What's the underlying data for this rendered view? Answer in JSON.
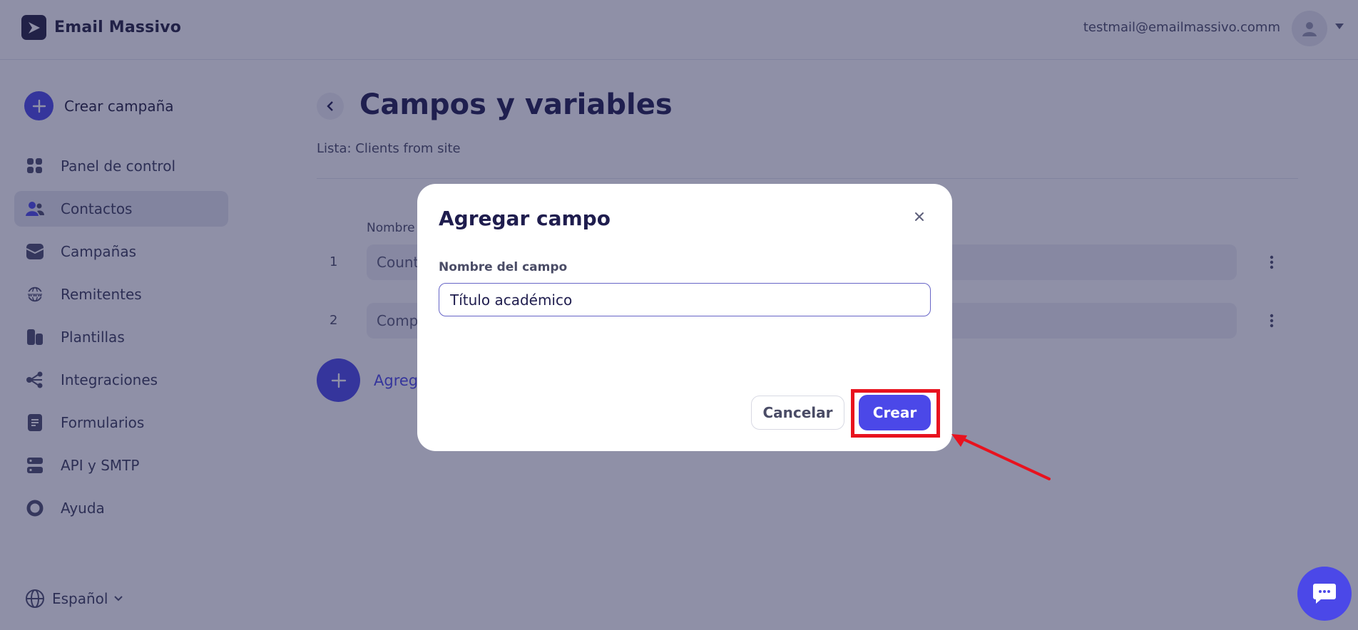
{
  "app": {
    "name": "Email Massivo",
    "user_email": "testmail@emailmassivo.comm"
  },
  "sidebar": {
    "create_label": "Crear campaña",
    "items": [
      {
        "label": "Panel de control",
        "icon": "dashboard-icon"
      },
      {
        "label": "Contactos",
        "icon": "contacts-icon",
        "active": true
      },
      {
        "label": "Campañas",
        "icon": "campaigns-icon"
      },
      {
        "label": "Remitentes",
        "icon": "senders-icon"
      },
      {
        "label": "Plantillas",
        "icon": "templates-icon"
      },
      {
        "label": "Integraciones",
        "icon": "integrations-icon"
      },
      {
        "label": "Formularios",
        "icon": "forms-icon"
      },
      {
        "label": "API y SMTP",
        "icon": "api-icon"
      },
      {
        "label": "Ayuda",
        "icon": "help-icon"
      }
    ],
    "language": "Español"
  },
  "main": {
    "title": "Campos y variables",
    "list_name": "Lista: Clients from site",
    "column_header": "Nombre",
    "fields": [
      {
        "num": "1",
        "value": "Count"
      },
      {
        "num": "2",
        "value": "Comp"
      }
    ],
    "add_label": "Agreg"
  },
  "modal": {
    "title": "Agregar campo",
    "field_label": "Nombre del campo",
    "field_value": "Título académico",
    "cancel_label": "Cancelar",
    "create_label": "Crear"
  },
  "colors": {
    "accent": "#4b48e8",
    "dark": "#1f1d4e",
    "annotation": "#e8121e"
  }
}
